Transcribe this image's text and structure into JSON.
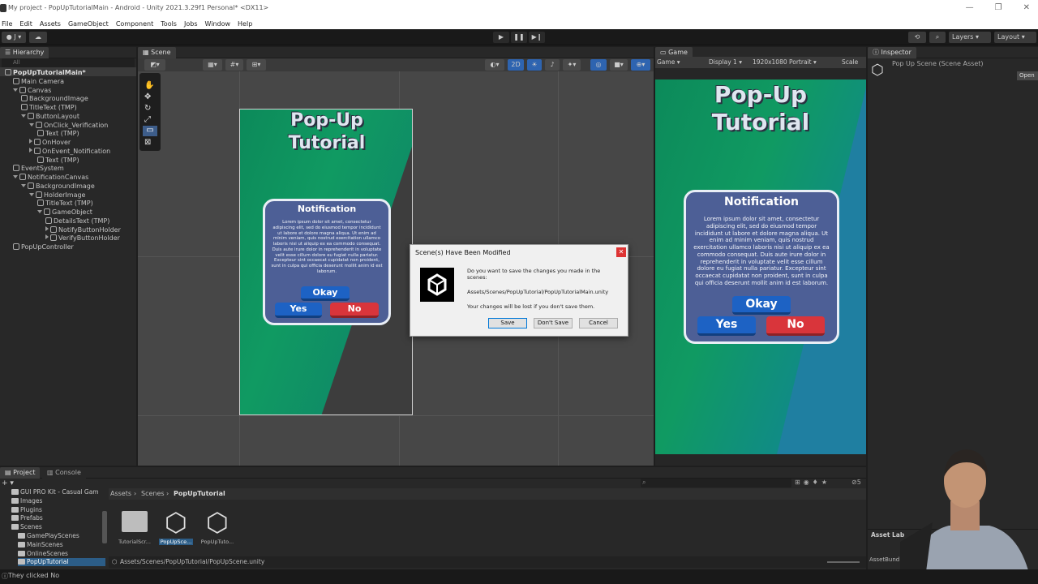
{
  "window": {
    "title": "My project - PopUpTutorialMain - Android - Unity 2021.3.29f1 Personal* <DX11>"
  },
  "menu": [
    "File",
    "Edit",
    "Assets",
    "GameObject",
    "Component",
    "Tools",
    "Jobs",
    "Window",
    "Help"
  ],
  "toolbar": {
    "account": "J",
    "layers": "Layers",
    "layout": "Layout"
  },
  "hierarchy": {
    "tab": "Hierarchy",
    "search_placeholder": "All",
    "items": [
      {
        "label": "PopUpTutorialMain*",
        "indent": 0,
        "kind": "scene"
      },
      {
        "label": "Main Camera",
        "indent": 1
      },
      {
        "label": "Canvas",
        "indent": 1,
        "expanded": true
      },
      {
        "label": "BackgroundImage",
        "indent": 2
      },
      {
        "label": "TitleText (TMP)",
        "indent": 2
      },
      {
        "label": "ButtonLayout",
        "indent": 2,
        "expanded": true
      },
      {
        "label": "OnClick_Verification",
        "indent": 3,
        "expanded": true
      },
      {
        "label": "Text (TMP)",
        "indent": 4
      },
      {
        "label": "OnHover",
        "indent": 3,
        "collapsed": true
      },
      {
        "label": "OnEvent_Notification",
        "indent": 3,
        "collapsed": true
      },
      {
        "label": "Text (TMP)",
        "indent": 4
      },
      {
        "label": "EventSystem",
        "indent": 1
      },
      {
        "label": "NotificationCanvas",
        "indent": 1,
        "expanded": true
      },
      {
        "label": "BackgroundImage",
        "indent": 2,
        "expanded": true
      },
      {
        "label": "HolderImage",
        "indent": 3,
        "expanded": true
      },
      {
        "label": "TitleText (TMP)",
        "indent": 4
      },
      {
        "label": "GameObject",
        "indent": 4,
        "expanded": true
      },
      {
        "label": "DetailsText (TMP)",
        "indent": 5
      },
      {
        "label": "NotifyButtonHolder",
        "indent": 5,
        "collapsed": true
      },
      {
        "label": "VerifyButtonHolder",
        "indent": 5,
        "collapsed": true
      },
      {
        "label": "PopUpController",
        "indent": 1
      }
    ]
  },
  "scene": {
    "tab": "Scene",
    "mode_2d": "2D"
  },
  "game": {
    "tab": "Game",
    "view": "Game",
    "display": "Display 1",
    "resolution": "1920x1080 Portrait",
    "scale": "Scale"
  },
  "ui_preview": {
    "title_line1": "Pop-Up",
    "title_line2": "Tutorial",
    "notification_title": "Notification",
    "notification_body": "Lorem ipsum dolor sit amet, consectetur adipiscing elit, sed do eiusmod tempor incididunt ut labore et dolore magna aliqua. Ut enim ad minim veniam, quis nostrud exercitation ullamco laboris nisi ut aliquip ex ea commodo consequat. Duis aute irure dolor in reprehenderit in voluptate velit esse cillum dolore eu fugiat nulla pariatur. Excepteur sint occaecat cupidatat non proident, sunt in culpa qui officia deserunt mollit anim id est laborum.",
    "okay": "Okay",
    "yes": "Yes",
    "no": "No"
  },
  "inspector": {
    "tab": "Inspector",
    "title": "Pop Up Scene (Scene Asset)",
    "open": "Open",
    "asset_label": "Asset Lab",
    "asset_bundle": "AssetBund"
  },
  "dialog": {
    "title": "Scene(s) Have Been Modified",
    "line1": "Do you want to save the changes you made in the",
    "line2": "scenes:",
    "path": "Assets/Scenes/PopUpTutorial/PopUpTutorialMain.unity",
    "warning": "Your changes will be lost if you don't save them.",
    "save": "Save",
    "dont_save": "Don't Save",
    "cancel": "Cancel"
  },
  "project": {
    "tab_project": "Project",
    "tab_console": "Console",
    "tree": [
      "GUI PRO Kit - Casual Gam",
      "Images",
      "Plugins",
      "Prefabs",
      "Scenes",
      "GamePlayScenes",
      "MainScenes",
      "OnlineScenes",
      "PopUpTutorial"
    ],
    "breadcrumb": [
      "Assets",
      "Scenes",
      "PopUpTutorial"
    ],
    "assets": [
      "TutorialScr...",
      "PopUpSce...",
      "PopUpTuto..."
    ],
    "footer_path": "Assets/Scenes/PopUpTutorial/PopUpScene.unity",
    "hidden_count": "5"
  },
  "status": {
    "message": "They clicked No"
  }
}
